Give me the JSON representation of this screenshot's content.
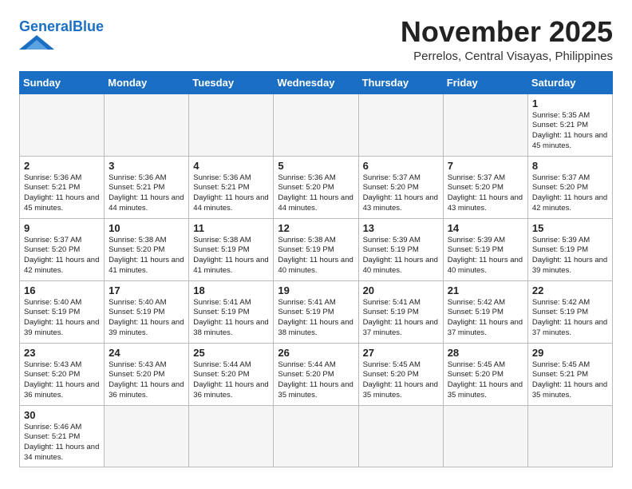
{
  "header": {
    "logo_general": "General",
    "logo_blue": "Blue",
    "month_title": "November 2025",
    "location": "Perrelos, Central Visayas, Philippines"
  },
  "weekdays": [
    "Sunday",
    "Monday",
    "Tuesday",
    "Wednesday",
    "Thursday",
    "Friday",
    "Saturday"
  ],
  "weeks": [
    [
      {
        "day": "",
        "info": ""
      },
      {
        "day": "",
        "info": ""
      },
      {
        "day": "",
        "info": ""
      },
      {
        "day": "",
        "info": ""
      },
      {
        "day": "",
        "info": ""
      },
      {
        "day": "",
        "info": ""
      },
      {
        "day": "1",
        "info": "Sunrise: 5:35 AM\nSunset: 5:21 PM\nDaylight: 11 hours\nand 45 minutes."
      }
    ],
    [
      {
        "day": "2",
        "info": "Sunrise: 5:36 AM\nSunset: 5:21 PM\nDaylight: 11 hours\nand 45 minutes."
      },
      {
        "day": "3",
        "info": "Sunrise: 5:36 AM\nSunset: 5:21 PM\nDaylight: 11 hours\nand 44 minutes."
      },
      {
        "day": "4",
        "info": "Sunrise: 5:36 AM\nSunset: 5:21 PM\nDaylight: 11 hours\nand 44 minutes."
      },
      {
        "day": "5",
        "info": "Sunrise: 5:36 AM\nSunset: 5:20 PM\nDaylight: 11 hours\nand 44 minutes."
      },
      {
        "day": "6",
        "info": "Sunrise: 5:37 AM\nSunset: 5:20 PM\nDaylight: 11 hours\nand 43 minutes."
      },
      {
        "day": "7",
        "info": "Sunrise: 5:37 AM\nSunset: 5:20 PM\nDaylight: 11 hours\nand 43 minutes."
      },
      {
        "day": "8",
        "info": "Sunrise: 5:37 AM\nSunset: 5:20 PM\nDaylight: 11 hours\nand 42 minutes."
      }
    ],
    [
      {
        "day": "9",
        "info": "Sunrise: 5:37 AM\nSunset: 5:20 PM\nDaylight: 11 hours\nand 42 minutes."
      },
      {
        "day": "10",
        "info": "Sunrise: 5:38 AM\nSunset: 5:20 PM\nDaylight: 11 hours\nand 41 minutes."
      },
      {
        "day": "11",
        "info": "Sunrise: 5:38 AM\nSunset: 5:19 PM\nDaylight: 11 hours\nand 41 minutes."
      },
      {
        "day": "12",
        "info": "Sunrise: 5:38 AM\nSunset: 5:19 PM\nDaylight: 11 hours\nand 40 minutes."
      },
      {
        "day": "13",
        "info": "Sunrise: 5:39 AM\nSunset: 5:19 PM\nDaylight: 11 hours\nand 40 minutes."
      },
      {
        "day": "14",
        "info": "Sunrise: 5:39 AM\nSunset: 5:19 PM\nDaylight: 11 hours\nand 40 minutes."
      },
      {
        "day": "15",
        "info": "Sunrise: 5:39 AM\nSunset: 5:19 PM\nDaylight: 11 hours\nand 39 minutes."
      }
    ],
    [
      {
        "day": "16",
        "info": "Sunrise: 5:40 AM\nSunset: 5:19 PM\nDaylight: 11 hours\nand 39 minutes."
      },
      {
        "day": "17",
        "info": "Sunrise: 5:40 AM\nSunset: 5:19 PM\nDaylight: 11 hours\nand 39 minutes."
      },
      {
        "day": "18",
        "info": "Sunrise: 5:41 AM\nSunset: 5:19 PM\nDaylight: 11 hours\nand 38 minutes."
      },
      {
        "day": "19",
        "info": "Sunrise: 5:41 AM\nSunset: 5:19 PM\nDaylight: 11 hours\nand 38 minutes."
      },
      {
        "day": "20",
        "info": "Sunrise: 5:41 AM\nSunset: 5:19 PM\nDaylight: 11 hours\nand 37 minutes."
      },
      {
        "day": "21",
        "info": "Sunrise: 5:42 AM\nSunset: 5:19 PM\nDaylight: 11 hours\nand 37 minutes."
      },
      {
        "day": "22",
        "info": "Sunrise: 5:42 AM\nSunset: 5:19 PM\nDaylight: 11 hours\nand 37 minutes."
      }
    ],
    [
      {
        "day": "23",
        "info": "Sunrise: 5:43 AM\nSunset: 5:20 PM\nDaylight: 11 hours\nand 36 minutes."
      },
      {
        "day": "24",
        "info": "Sunrise: 5:43 AM\nSunset: 5:20 PM\nDaylight: 11 hours\nand 36 minutes."
      },
      {
        "day": "25",
        "info": "Sunrise: 5:44 AM\nSunset: 5:20 PM\nDaylight: 11 hours\nand 36 minutes."
      },
      {
        "day": "26",
        "info": "Sunrise: 5:44 AM\nSunset: 5:20 PM\nDaylight: 11 hours\nand 35 minutes."
      },
      {
        "day": "27",
        "info": "Sunrise: 5:45 AM\nSunset: 5:20 PM\nDaylight: 11 hours\nand 35 minutes."
      },
      {
        "day": "28",
        "info": "Sunrise: 5:45 AM\nSunset: 5:20 PM\nDaylight: 11 hours\nand 35 minutes."
      },
      {
        "day": "29",
        "info": "Sunrise: 5:45 AM\nSunset: 5:21 PM\nDaylight: 11 hours\nand 35 minutes."
      }
    ],
    [
      {
        "day": "30",
        "info": "Sunrise: 5:46 AM\nSunset: 5:21 PM\nDaylight: 11 hours\nand 34 minutes."
      },
      {
        "day": "",
        "info": ""
      },
      {
        "day": "",
        "info": ""
      },
      {
        "day": "",
        "info": ""
      },
      {
        "day": "",
        "info": ""
      },
      {
        "day": "",
        "info": ""
      },
      {
        "day": "",
        "info": ""
      }
    ]
  ]
}
